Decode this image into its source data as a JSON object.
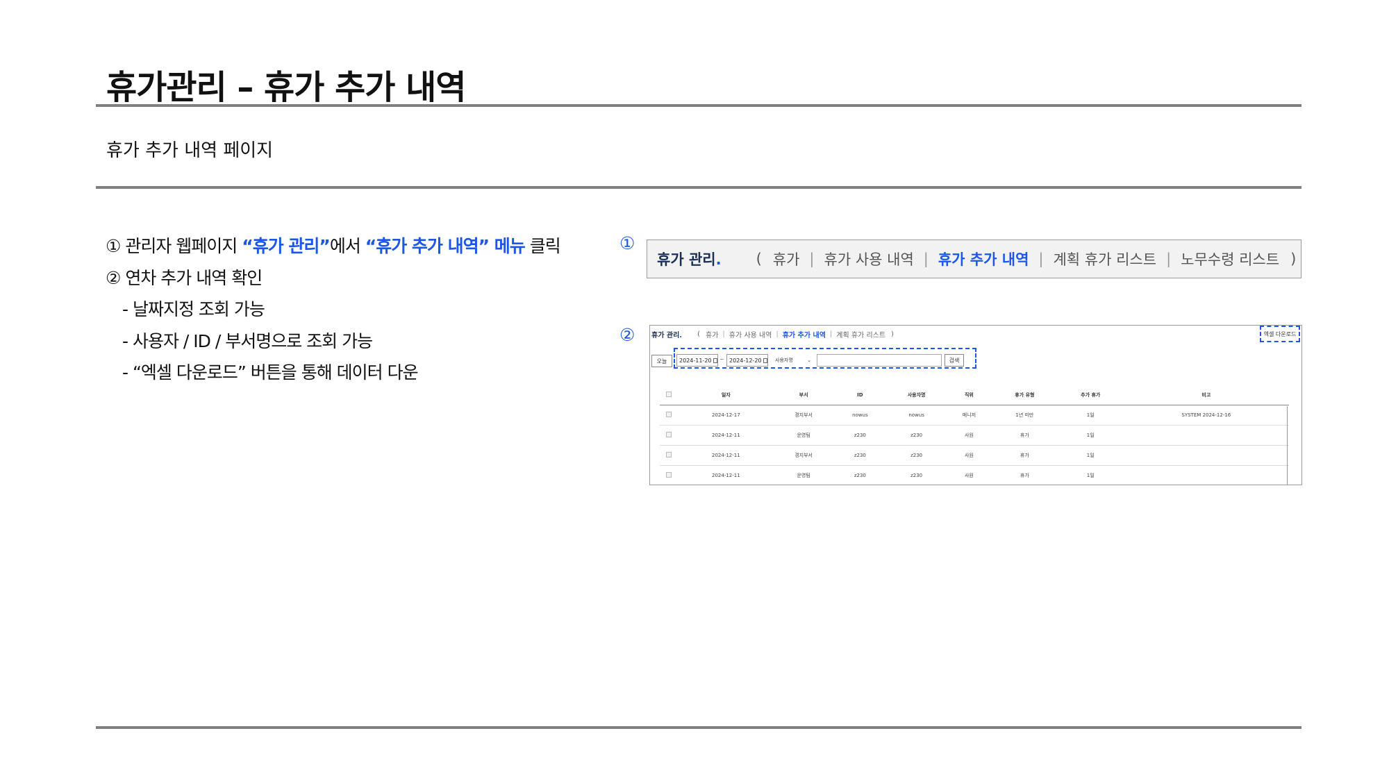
{
  "title": "휴가관리 – 휴가 추가 내역",
  "subtitle": "휴가 추가 내역 페이지",
  "steps": {
    "step1": {
      "prefix": "① 관리자 웹페이지 ",
      "hl1": "“휴가 관리”",
      "mid": "에서 ",
      "hl2": "“휴가 추가 내역” 메뉴",
      "suffix": " 클릭"
    },
    "step2": "② 연차 추가  내역 확인",
    "bullets": [
      "- 날짜지정 조회 가능",
      "- 사용자 / ID / 부서명으로 조회 가능",
      "- “엑셀 다운로드” 버튼을 통해 데이터 다운"
    ]
  },
  "markers": {
    "m1": "①",
    "m2": "②"
  },
  "nav": {
    "brand": "휴가 관리",
    "brand_dot": ".",
    "open_paren": "(",
    "close_paren": ")",
    "separator": "|",
    "items": [
      "휴가",
      "휴가 사용 내역",
      "휴가 추가 내역",
      "계획 휴가 리스트",
      "노무수령 리스트"
    ],
    "active_index": 2
  },
  "screenshot": {
    "nav_items": [
      "휴가",
      "휴가 사용 내역",
      "휴가 추가 내역",
      "계획 휴가 리스트"
    ],
    "excel_button": "엑셀 다운로드",
    "today_button": "오늘",
    "date_from": "2024-11-20",
    "date_to": "2024-12-20",
    "tilde": "~",
    "select_value": "사용자명",
    "select_caret": "⌄",
    "search_button": "검색",
    "columns": [
      "일자",
      "부서",
      "ID",
      "사용자명",
      "직위",
      "휴가 유형",
      "추가 휴가",
      "비고"
    ],
    "rows": [
      [
        "2024-12-17",
        "경지부서",
        "nowus",
        "nowus",
        "매니저",
        "1년 미만",
        "1일",
        "SYSTEM 2024-12-16"
      ],
      [
        "2024-12-11",
        "운영팀",
        "z230",
        "z230",
        "사원",
        "휴가",
        "1일",
        ""
      ],
      [
        "2024-12-11",
        "경지부서",
        "z230",
        "z230",
        "사원",
        "휴가",
        "1일",
        ""
      ],
      [
        "2024-12-11",
        "운영팀",
        "z230",
        "z230",
        "사원",
        "휴가",
        "1일",
        ""
      ]
    ]
  }
}
